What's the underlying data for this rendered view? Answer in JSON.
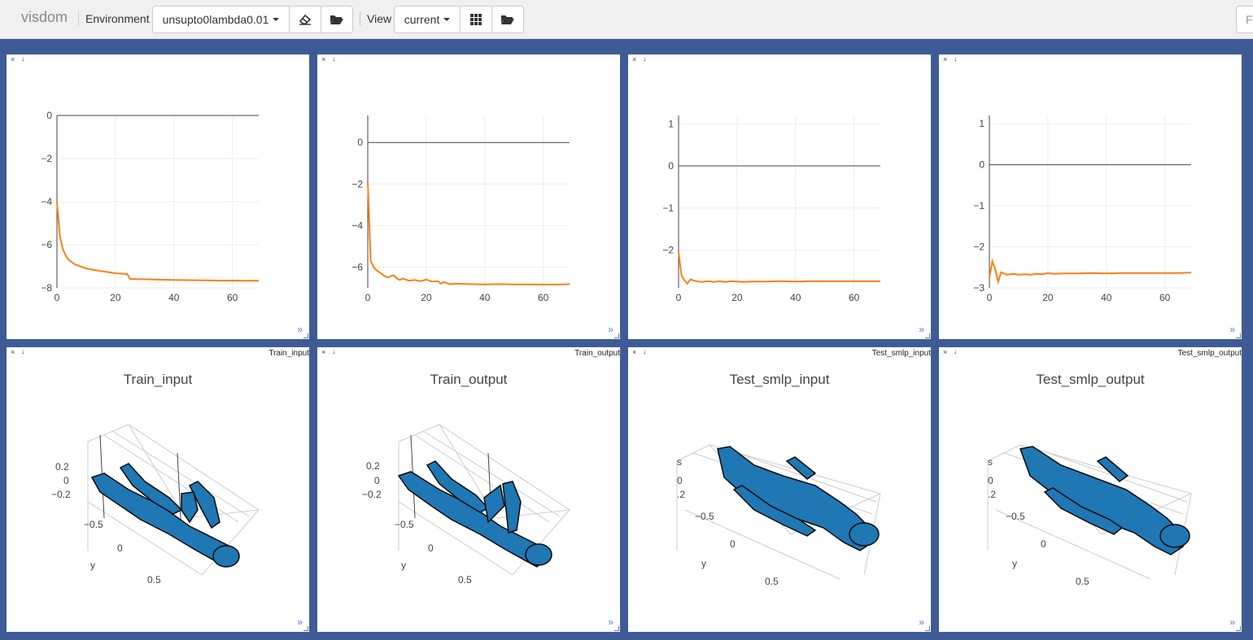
{
  "app": {
    "brand": "visdom"
  },
  "toolbar": {
    "environment_label": "Environment",
    "environment_value": "unsupto0lambda0.01",
    "view_label": "View",
    "view_value": "current",
    "filter_placeholder": "F"
  },
  "icons": {
    "clear": "eraser-icon",
    "manage_env": "folder-open-icon",
    "layout": "grid-icon",
    "manage_views": "folder-open-icon"
  },
  "colors": {
    "background": "#3f5b96",
    "line": "#ff7f0e",
    "mesh": "#1f77b4"
  },
  "panes": [
    {
      "close": "×",
      "download": "↓",
      "title": "",
      "expand": "»"
    },
    {
      "close": "×",
      "download": "↓",
      "title": "",
      "expand": "»"
    },
    {
      "close": "×",
      "download": "↓",
      "title": "",
      "expand": "»"
    },
    {
      "close": "×",
      "download": "↓",
      "title": "",
      "expand": "»"
    },
    {
      "close": "×",
      "download": "↓",
      "title": "Train_input",
      "expand": "»",
      "chart_title": "Train_input"
    },
    {
      "close": "×",
      "download": "↓",
      "title": "Train_output",
      "expand": "»",
      "chart_title": "Train_output"
    },
    {
      "close": "×",
      "download": "↓",
      "title": "Test_smlp_input",
      "expand": "»",
      "chart_title": "Test_smlp_input"
    },
    {
      "close": "×",
      "download": "↓",
      "title": "Test_smlp_output",
      "expand": "»",
      "chart_title": "Test_smlp_output"
    }
  ],
  "chart_data": [
    {
      "type": "line",
      "title": "",
      "xlim": [
        0,
        69
      ],
      "ylim": [
        -8,
        0
      ],
      "xticks": [
        0,
        20,
        40,
        60
      ],
      "yticks": [
        0,
        -2,
        -4,
        -6,
        -8
      ],
      "grid": true,
      "x": [
        0,
        1,
        2,
        3,
        4,
        5,
        6,
        8,
        10,
        12,
        15,
        18,
        20,
        23,
        24,
        25,
        28,
        30,
        35,
        40,
        45,
        50,
        55,
        60,
        65,
        69
      ],
      "y": [
        -4.0,
        -5.6,
        -6.2,
        -6.5,
        -6.7,
        -6.8,
        -6.9,
        -7.0,
        -7.1,
        -7.15,
        -7.22,
        -7.28,
        -7.32,
        -7.35,
        -7.36,
        -7.58,
        -7.6,
        -7.6,
        -7.62,
        -7.63,
        -7.64,
        -7.65,
        -7.66,
        -7.66,
        -7.67,
        -7.67
      ]
    },
    {
      "type": "line",
      "title": "",
      "xlim": [
        0,
        69
      ],
      "ylim": [
        -7,
        1.3
      ],
      "xticks": [
        0,
        20,
        40,
        60
      ],
      "yticks": [
        0,
        -2,
        -4,
        -6
      ],
      "grid": true,
      "x": [
        0,
        1,
        2,
        3,
        4,
        5,
        6,
        7,
        8,
        9,
        10,
        11,
        12,
        14,
        16,
        18,
        20,
        22,
        24,
        25,
        26,
        28,
        30,
        35,
        40,
        45,
        50,
        55,
        60,
        65,
        69
      ],
      "y": [
        -1.9,
        -5.7,
        -6.0,
        -6.15,
        -6.25,
        -6.35,
        -6.45,
        -6.5,
        -6.42,
        -6.4,
        -6.55,
        -6.62,
        -6.55,
        -6.65,
        -6.62,
        -6.68,
        -6.6,
        -6.7,
        -6.68,
        -6.8,
        -6.72,
        -6.82,
        -6.8,
        -6.82,
        -6.83,
        -6.82,
        -6.83,
        -6.83,
        -6.84,
        -6.84,
        -6.82
      ]
    },
    {
      "type": "line",
      "title": "",
      "xlim": [
        0,
        69
      ],
      "ylim": [
        -2.9,
        1.2
      ],
      "xticks": [
        0,
        20,
        40,
        60
      ],
      "yticks": [
        1,
        0,
        -1,
        -2
      ],
      "grid": true,
      "x": [
        0,
        1,
        2,
        3,
        4,
        5,
        6,
        8,
        10,
        12,
        14,
        16,
        18,
        20,
        22,
        25,
        30,
        35,
        40,
        45,
        50,
        55,
        60,
        65,
        69
      ],
      "y": [
        -2.05,
        -2.6,
        -2.72,
        -2.8,
        -2.7,
        -2.72,
        -2.74,
        -2.76,
        -2.74,
        -2.76,
        -2.74,
        -2.76,
        -2.74,
        -2.75,
        -2.76,
        -2.75,
        -2.75,
        -2.74,
        -2.75,
        -2.74,
        -2.74,
        -2.74,
        -2.74,
        -2.74,
        -2.74
      ]
    },
    {
      "type": "line",
      "title": "",
      "xlim": [
        0,
        69
      ],
      "ylim": [
        -3,
        1.2
      ],
      "xticks": [
        0,
        20,
        40,
        60
      ],
      "yticks": [
        1,
        0,
        -1,
        -2,
        -3
      ],
      "grid": true,
      "x": [
        0,
        1,
        2,
        3,
        4,
        6,
        8,
        10,
        12,
        14,
        16,
        18,
        20,
        22,
        25,
        30,
        35,
        40,
        45,
        50,
        55,
        60,
        65,
        69
      ],
      "y": [
        -2.75,
        -2.35,
        -2.55,
        -2.85,
        -2.62,
        -2.68,
        -2.66,
        -2.68,
        -2.67,
        -2.68,
        -2.66,
        -2.67,
        -2.64,
        -2.66,
        -2.65,
        -2.65,
        -2.64,
        -2.65,
        -2.64,
        -2.64,
        -2.64,
        -2.64,
        -2.64,
        -2.63
      ]
    }
  ]
}
